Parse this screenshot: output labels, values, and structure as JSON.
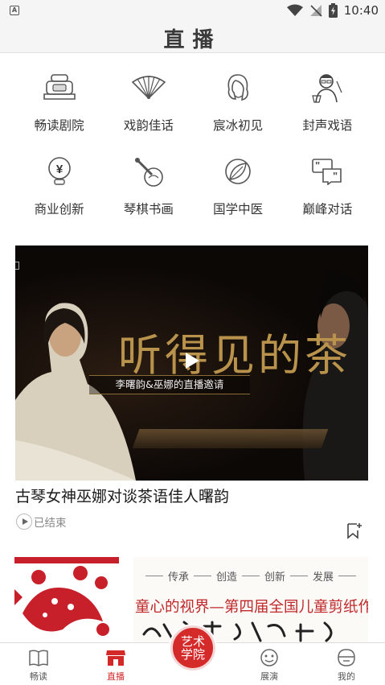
{
  "status_bar": {
    "app_badge": "A",
    "time": "10:40"
  },
  "header": {
    "title": "直播"
  },
  "categories": [
    {
      "label": "畅读剧院",
      "icon": "theater-icon"
    },
    {
      "label": "戏韵佳话",
      "icon": "fan-icon"
    },
    {
      "label": "宸冰初见",
      "icon": "portrait-woman-icon"
    },
    {
      "label": "封声戏语",
      "icon": "portrait-man-icon"
    },
    {
      "label": "商业创新",
      "icon": "yuan-bulb-icon"
    },
    {
      "label": "琴棋书画",
      "icon": "instruments-icon"
    },
    {
      "label": "国学中医",
      "icon": "leaf-icon"
    },
    {
      "label": "巅峰对话",
      "icon": "dialogue-icon"
    }
  ],
  "video": {
    "overlay_title": "听得见的茶",
    "overlay_subtitle": "李曙韵&巫娜的直播邀请",
    "caption": "古琴女神巫娜对谈茶语佳人曙韵",
    "status": "已结束"
  },
  "card2": {
    "tags": [
      "传承",
      "创造",
      "创新",
      "发展"
    ],
    "title": "童心的视界—第四届全国儿童剪纸作品"
  },
  "bottom_nav": {
    "items": [
      {
        "label": "畅读",
        "icon": "book-icon"
      },
      {
        "label": "直播",
        "icon": "live-shop-icon"
      },
      {
        "label": "展演",
        "icon": "performance-icon"
      },
      {
        "label": "我的",
        "icon": "profile-face-icon"
      }
    ],
    "active": "直播",
    "center_button": "艺术学院"
  },
  "colors": {
    "accent": "#d22828",
    "gold": "#b9934b"
  }
}
